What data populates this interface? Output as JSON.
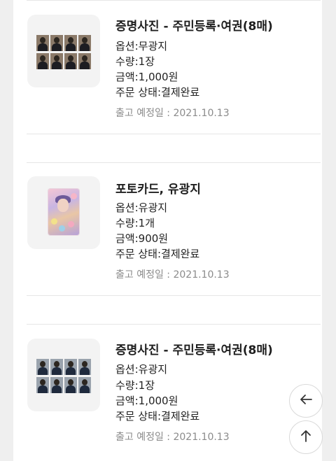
{
  "orders": [
    {
      "title": "증명사진 - 주민등록·여권(8매)",
      "option": "옵션:무광지",
      "quantity": "수량:1장",
      "amount": "금액:1,000원",
      "status": "주문 상태:결제완료",
      "ship_date": "출고 예정일 : 2021.10.13"
    },
    {
      "title": "포토카드, 유광지",
      "option": "옵션:유광지",
      "quantity": "수량:1개",
      "amount": "금액:900원",
      "status": "주문 상태:결제완료",
      "ship_date": "출고 예정일 : 2021.10.13"
    },
    {
      "title": "증명사진 - 주민등록·여권(8매)",
      "option": "옵션:유광지",
      "quantity": "수량:1장",
      "amount": "금액:1,000원",
      "status": "주문 상태:결제완료",
      "ship_date": "출고 예정일 : 2021.10.13"
    }
  ],
  "icons": {
    "back": "arrow-left-icon",
    "top": "arrow-up-icon"
  }
}
